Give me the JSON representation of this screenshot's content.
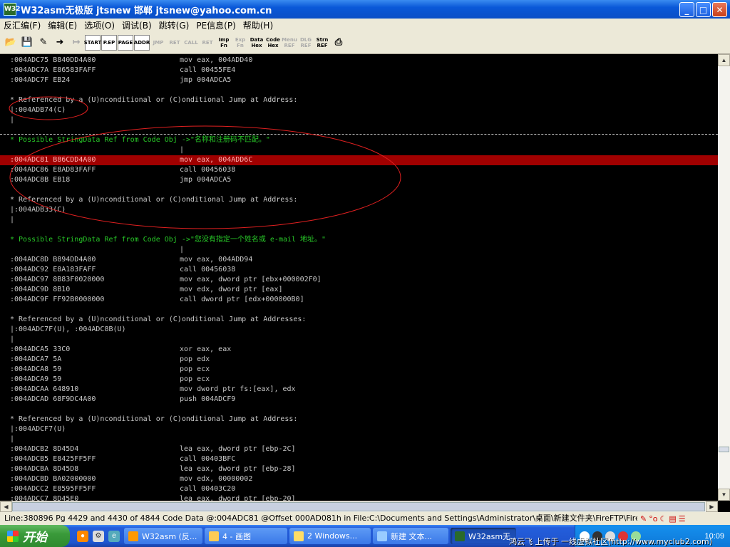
{
  "window": {
    "title": "W32asm无极版 jtsnew 邯郸  jtsnew@yahoo.com.cn",
    "app_icon": "W32"
  },
  "menu": [
    "反汇编(F)",
    "编辑(E)",
    "选项(O)",
    "调试(B)",
    "跳转(G)",
    "PE信息(P)",
    "帮助(H)"
  ],
  "toolbar": [
    {
      "name": "open-icon",
      "label": "",
      "style": "plain"
    },
    {
      "name": "save-icon",
      "label": "",
      "style": "plain"
    },
    {
      "name": "pen-icon",
      "label": "",
      "style": "plain"
    },
    {
      "name": "goto-icon",
      "label": "",
      "style": "plain"
    },
    {
      "name": "nav-icon",
      "label": "",
      "style": "dim"
    },
    {
      "name": "start-icon",
      "label": "START",
      "style": "boxed"
    },
    {
      "name": "pe-icon",
      "label": "P.EP",
      "style": "boxed"
    },
    {
      "name": "page-icon",
      "label": "PAGE",
      "style": "boxed"
    },
    {
      "name": "addr-icon",
      "label": "ADDR",
      "style": "boxed"
    },
    {
      "name": "jmp-icon",
      "label": "JMP",
      "style": "dim"
    },
    {
      "name": "ret-icon",
      "label": "RET",
      "style": "dim"
    },
    {
      "name": "call-icon",
      "label": "CALL",
      "style": "dim"
    },
    {
      "name": "ret2-icon",
      "label": "RET",
      "style": "dim"
    },
    {
      "name": "imp-fn-icon",
      "label": "Imp Fn",
      "style": "plain"
    },
    {
      "name": "exp-fn-icon",
      "label": "Exp Fn",
      "style": "dim"
    },
    {
      "name": "data-hex-icon",
      "label": "Data Hex",
      "style": "plain"
    },
    {
      "name": "code-hex-icon",
      "label": "Code Hex",
      "style": "plain"
    },
    {
      "name": "menu-ref-icon",
      "label": "Menu REF",
      "style": "dim"
    },
    {
      "name": "dlg-ref-icon",
      "label": "DLG REF",
      "style": "dim"
    },
    {
      "name": "strn-ref-icon",
      "label": "Strn REF",
      "style": "plain"
    },
    {
      "name": "print-icon",
      "label": "",
      "style": "plain"
    }
  ],
  "listing": [
    {
      "a": ":004ADC75 B840DD4A00",
      "b": "mov eax, 004ADD40",
      "t": "code"
    },
    {
      "a": ":004ADC7A E86583FAFF",
      "b": "call 00455FE4",
      "t": "code"
    },
    {
      "a": ":004ADC7F EB24",
      "b": "jmp 004ADCA5",
      "t": "code"
    },
    {
      "a": "",
      "b": "",
      "t": "blank"
    },
    {
      "a": "* Referenced by a (U)nconditional or (C)onditional Jump at Address:",
      "b": "",
      "t": "text"
    },
    {
      "a": "|:004ADB74(C)",
      "b": "",
      "t": "text"
    },
    {
      "a": "|",
      "b": "",
      "t": "text"
    },
    {
      "a": "",
      "b": "",
      "t": "blank"
    },
    {
      "a": "* Possible StringData Ref from Code Obj ->\"名称和注册码不匹配。\"",
      "b": "",
      "t": "green"
    },
    {
      "a": "",
      "b": "|",
      "t": "text"
    },
    {
      "a": ":004ADC81 B86CDD4A00",
      "b": "mov eax, 004ADD6C",
      "t": "hl"
    },
    {
      "a": ":004ADC86 E8AD83FAFF",
      "b": "call 00456038",
      "t": "code"
    },
    {
      "a": ":004ADC8B EB18",
      "b": "jmp 004ADCA5",
      "t": "code"
    },
    {
      "a": "",
      "b": "",
      "t": "blank"
    },
    {
      "a": "* Referenced by a (U)nconditional or (C)onditional Jump at Address:",
      "b": "",
      "t": "text"
    },
    {
      "a": "|:004ADB33(C)",
      "b": "",
      "t": "text"
    },
    {
      "a": "|",
      "b": "",
      "t": "text"
    },
    {
      "a": "",
      "b": "",
      "t": "blank"
    },
    {
      "a": "* Possible StringData Ref from Code Obj ->\"您没有指定一个姓名或 e-mail 地址。\"",
      "b": "",
      "t": "green"
    },
    {
      "a": "",
      "b": "|",
      "t": "text"
    },
    {
      "a": ":004ADC8D B894DD4A00",
      "b": "mov eax, 004ADD94",
      "t": "code"
    },
    {
      "a": ":004ADC92 E8A183FAFF",
      "b": "call 00456038",
      "t": "code"
    },
    {
      "a": ":004ADC97 8B83F0020000",
      "b": "mov eax, dword ptr [ebx+000002F0]",
      "t": "code"
    },
    {
      "a": ":004ADC9D 8B10",
      "b": "mov edx, dword ptr [eax]",
      "t": "code"
    },
    {
      "a": ":004ADC9F FF92B0000000",
      "b": "call dword ptr [edx+000000B0]",
      "t": "code"
    },
    {
      "a": "",
      "b": "",
      "t": "blank"
    },
    {
      "a": "* Referenced by a (U)nconditional or (C)onditional Jump at Addresses:",
      "b": "",
      "t": "text"
    },
    {
      "a": "|:004ADC7F(U), :004ADC8B(U)",
      "b": "",
      "t": "text"
    },
    {
      "a": "|",
      "b": "",
      "t": "text"
    },
    {
      "a": ":004ADCA5 33C0",
      "b": "xor eax, eax",
      "t": "code"
    },
    {
      "a": ":004ADCA7 5A",
      "b": "pop edx",
      "t": "code"
    },
    {
      "a": ":004ADCA8 59",
      "b": "pop ecx",
      "t": "code"
    },
    {
      "a": ":004ADCA9 59",
      "b": "pop ecx",
      "t": "code"
    },
    {
      "a": ":004ADCAA 648910",
      "b": "mov dword ptr fs:[eax], edx",
      "t": "code"
    },
    {
      "a": ":004ADCAD 68F9DC4A00",
      "b": "push 004ADCF9",
      "t": "code"
    },
    {
      "a": "",
      "b": "",
      "t": "blank"
    },
    {
      "a": "* Referenced by a (U)nconditional or (C)onditional Jump at Address:",
      "b": "",
      "t": "text"
    },
    {
      "a": "|:004ADCF7(U)",
      "b": "",
      "t": "text"
    },
    {
      "a": "|",
      "b": "",
      "t": "text"
    },
    {
      "a": ":004ADCB2 8D45D4",
      "b": "lea eax, dword ptr [ebp-2C]",
      "t": "code"
    },
    {
      "a": ":004ADCB5 E8425FF5FF",
      "b": "call 00403BFC",
      "t": "code"
    },
    {
      "a": ":004ADCBA 8D45D8",
      "b": "lea eax, dword ptr [ebp-28]",
      "t": "code"
    },
    {
      "a": ":004ADCBD BA02000000",
      "b": "mov edx, 00000002",
      "t": "code"
    },
    {
      "a": ":004ADCC2 E8595FF5FF",
      "b": "call 00403C20",
      "t": "code"
    },
    {
      "a": ":004ADCC7 8D45E0",
      "b": "lea eax, dword ptr [ebp-20]",
      "t": "code"
    }
  ],
  "status": "Line:380896 Pg 4429 and 4430 of 4844  Code Data @:004ADC81 @Offset 000AD081h in File:C:\\Documents and Settings\\Administrator\\桌面\\新建文件夹\\FireFTP\\FireFTP\\ftp.exe",
  "taskbar": {
    "start_label": "开始",
    "tasks": [
      "W32asm (反...",
      "4 - 画图",
      "2 Windows...",
      "新建 文本...",
      "W32asm无..."
    ],
    "clock": "10:09",
    "watermark": "鸿云飞 上传于 一线虚拟社区(http://www.myclub2.com)"
  },
  "colors": {
    "highlight": "#a00000",
    "string_ref": "#28c828",
    "annotation": "#e02020"
  }
}
